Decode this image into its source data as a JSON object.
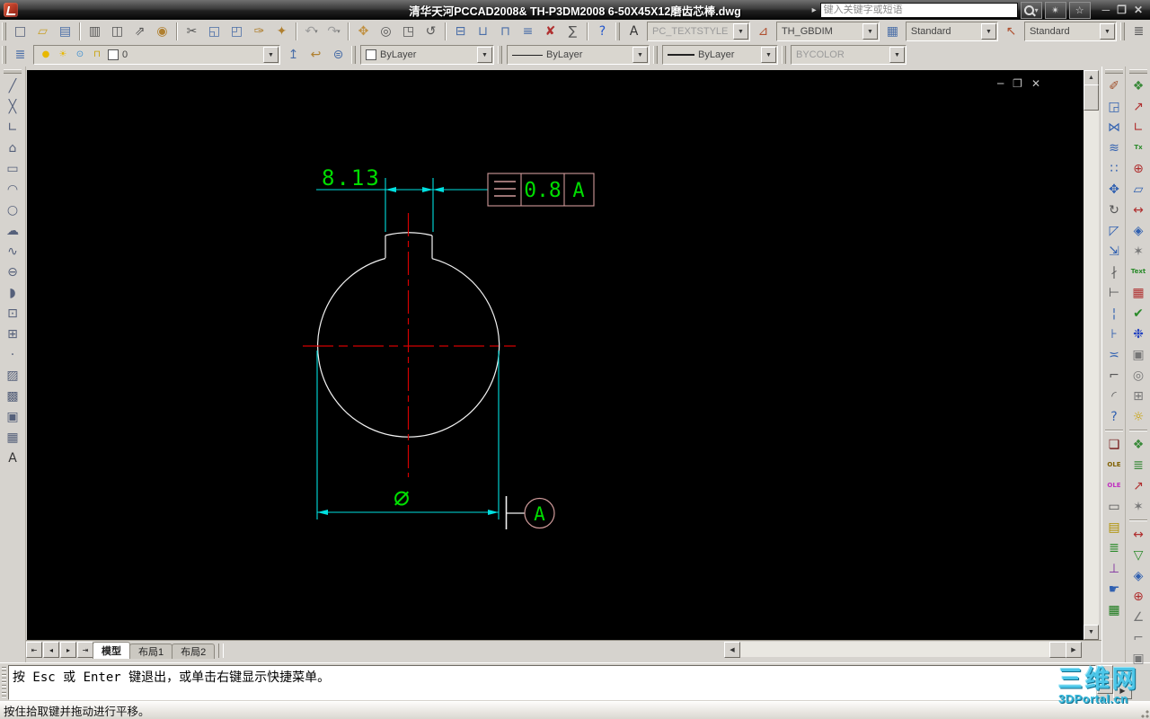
{
  "title_bar": {
    "app_title": "清华天河PCCAD2008& TH-P3DM2008 6-50X45X12磨齿芯棒.dwg",
    "comm_arrow": "▸",
    "search": {
      "placeholder": "键入关键字或短语"
    },
    "window_controls": {
      "minimize": "─",
      "restore": "❐",
      "close": "✕"
    }
  },
  "doc_window_controls": {
    "minimize": "─",
    "restore": "❐",
    "close": "✕"
  },
  "styles": {
    "text_style": {
      "value": "PC_TEXTSTYLE",
      "disabled": true
    },
    "dim_style": {
      "value": "TH_GBDIM"
    },
    "table_style": {
      "value": "Standard"
    },
    "mleader_style": {
      "value": "Standard"
    }
  },
  "layers": {
    "current_layer": "0",
    "color_value": "ByLayer",
    "linetype_value": "ByLayer",
    "lineweight_value": "ByLayer",
    "plot_style_value": "BYCOLOR"
  },
  "toolbars": {
    "standard": [
      {
        "type": "grip"
      },
      {
        "name": "new-drawing",
        "glyph": "□",
        "color": "#55607a"
      },
      {
        "name": "open-drawing",
        "glyph": "▱",
        "color": "#c8a028"
      },
      {
        "name": "save-drawing",
        "glyph": "▤",
        "color": "#4a6ea8"
      },
      {
        "type": "sep"
      },
      {
        "name": "print",
        "glyph": "▥",
        "color": "#555555"
      },
      {
        "name": "print-preview",
        "glyph": "◫",
        "color": "#555555"
      },
      {
        "name": "publish",
        "glyph": "⇗",
        "color": "#555555"
      },
      {
        "name": "plot-orb",
        "glyph": "◉",
        "color": "#b08030"
      },
      {
        "type": "sep"
      },
      {
        "name": "cut",
        "glyph": "✂",
        "color": "#555555"
      },
      {
        "name": "copy-clip",
        "glyph": "◱",
        "color": "#4a6ea8"
      },
      {
        "name": "paste-clip",
        "glyph": "◰",
        "color": "#4a6ea8"
      },
      {
        "name": "match-properties",
        "glyph": "✑",
        "color": "#b08030"
      },
      {
        "name": "block-editor",
        "glyph": "✦",
        "color": "#b08030"
      },
      {
        "type": "sep"
      },
      {
        "name": "undo",
        "glyph": "↶",
        "color": "#9c9c9c",
        "dd": true,
        "disabled": true
      },
      {
        "name": "redo",
        "glyph": "↷",
        "color": "#9c9c9c",
        "dd": true,
        "disabled": true
      },
      {
        "type": "sep"
      },
      {
        "name": "pan-realtime",
        "glyph": "✥",
        "color": "#c09040"
      },
      {
        "name": "zoom-realtime",
        "glyph": "◎",
        "color": "#555555"
      },
      {
        "name": "zoom-window",
        "glyph": "◳",
        "color": "#555555"
      },
      {
        "name": "zoom-previous",
        "glyph": "↺",
        "color": "#555555"
      },
      {
        "type": "sep"
      },
      {
        "name": "properties-palette",
        "glyph": "⊟",
        "color": "#4a6ea8"
      },
      {
        "name": "design-center",
        "glyph": "⊔",
        "color": "#4a6ea8"
      },
      {
        "name": "tool-palettes",
        "glyph": "⊓",
        "color": "#4a6ea8"
      },
      {
        "name": "sheet-set-manager",
        "glyph": "≡",
        "color": "#4a6ea8"
      },
      {
        "name": "markup-set-manager",
        "glyph": "✘",
        "color": "#b03030"
      },
      {
        "name": "quick-calc",
        "glyph": "∑",
        "color": "#555555"
      },
      {
        "type": "sep"
      },
      {
        "name": "help",
        "glyph": "?",
        "color": "#2255cc"
      },
      {
        "type": "grip"
      }
    ],
    "text_style_icon": [
      {
        "name": "text-style",
        "glyph": "A",
        "color": "#333333"
      }
    ],
    "dim_style_icon": [
      {
        "name": "dim-style",
        "glyph": "⊿",
        "color": "#b05030"
      }
    ],
    "table_style_icon": [
      {
        "name": "table-style",
        "glyph": "▦",
        "color": "#4a6ea8"
      }
    ],
    "mleader_style_icon": [
      {
        "name": "mleader-style",
        "glyph": "↖",
        "color": "#b05030"
      }
    ],
    "row1_tail": [
      {
        "type": "grip"
      },
      {
        "name": "clipped-toolbar",
        "glyph": "≣",
        "color": "#555555"
      }
    ],
    "layers_left": [
      {
        "type": "grip"
      },
      {
        "name": "layer-properties-manager",
        "glyph": "≣",
        "color": "#4a6ea8"
      }
    ],
    "layer_states": [
      {
        "name": "layer-on",
        "glyph": "●",
        "color": "#e8b800"
      },
      {
        "name": "layer-freeze",
        "glyph": "☀",
        "color": "#e8b800"
      },
      {
        "name": "layer-vp-freeze",
        "glyph": "⊙",
        "color": "#4090d0"
      },
      {
        "name": "layer-lock",
        "glyph": "⊓",
        "color": "#c8a000"
      }
    ],
    "layer_tools": [
      {
        "name": "make-object-layer-current",
        "glyph": "↥",
        "color": "#4a6ea8"
      },
      {
        "name": "layer-previous",
        "glyph": "↩",
        "color": "#b08030"
      },
      {
        "name": "layer-states-manager",
        "glyph": "⊜",
        "color": "#4a6ea8"
      }
    ],
    "draw": [
      {
        "type": "grip"
      },
      {
        "name": "line",
        "glyph": "╱",
        "color": "#55607a"
      },
      {
        "name": "construction-line",
        "glyph": "╳",
        "color": "#55607a"
      },
      {
        "name": "polyline",
        "glyph": "∟",
        "color": "#55607a"
      },
      {
        "name": "polygon",
        "glyph": "⌂",
        "color": "#55607a"
      },
      {
        "name": "rectangle",
        "glyph": "▭",
        "color": "#55607a"
      },
      {
        "name": "arc",
        "glyph": "◠",
        "color": "#55607a"
      },
      {
        "name": "circle",
        "glyph": "○",
        "color": "#55607a"
      },
      {
        "name": "revision-cloud",
        "glyph": "☁",
        "color": "#55607a"
      },
      {
        "name": "spline",
        "glyph": "∿",
        "color": "#55607a"
      },
      {
        "name": "ellipse",
        "glyph": "⊖",
        "color": "#55607a"
      },
      {
        "name": "ellipse-arc",
        "glyph": "◗",
        "color": "#55607a"
      },
      {
        "name": "insert-block",
        "glyph": "⊡",
        "color": "#55607a"
      },
      {
        "name": "make-block",
        "glyph": "⊞",
        "color": "#55607a"
      },
      {
        "name": "point",
        "glyph": "·",
        "color": "#55607a"
      },
      {
        "name": "hatch",
        "glyph": "▨",
        "color": "#55607a"
      },
      {
        "name": "gradient",
        "glyph": "▩",
        "color": "#55607a"
      },
      {
        "name": "region",
        "glyph": "▣",
        "color": "#55607a"
      },
      {
        "name": "table",
        "glyph": "▦",
        "color": "#55607a"
      },
      {
        "name": "multiline-text",
        "glyph": "A",
        "color": "#333333"
      }
    ],
    "modify": [
      {
        "type": "grip"
      },
      {
        "name": "erase",
        "glyph": "✐",
        "color": "#a0522d"
      },
      {
        "name": "copy-object",
        "glyph": "◲",
        "color": "#3060b0"
      },
      {
        "name": "mirror",
        "glyph": "⋈",
        "color": "#3060b0"
      },
      {
        "name": "offset",
        "glyph": "≋",
        "color": "#3060b0"
      },
      {
        "name": "array",
        "glyph": "∷",
        "color": "#3060b0"
      },
      {
        "name": "move",
        "glyph": "✥",
        "color": "#3060b0"
      },
      {
        "name": "rotate",
        "glyph": "↻",
        "color": "#555555"
      },
      {
        "name": "scale",
        "glyph": "◸",
        "color": "#3060b0"
      },
      {
        "name": "stretch",
        "glyph": "⇲",
        "color": "#3060b0"
      },
      {
        "name": "trim",
        "glyph": "∤",
        "color": "#555555"
      },
      {
        "name": "extend",
        "glyph": "⊢",
        "color": "#555555"
      },
      {
        "name": "break",
        "glyph": "¦",
        "color": "#3060b0"
      },
      {
        "name": "break-at-point",
        "glyph": "⊦",
        "color": "#3060b0"
      },
      {
        "name": "join",
        "glyph": "≍",
        "color": "#3060b0"
      },
      {
        "name": "chamfer",
        "glyph": "⌐",
        "color": "#555555"
      },
      {
        "name": "fillet",
        "glyph": "◜",
        "color": "#555555"
      },
      {
        "name": "modify-help",
        "glyph": "?",
        "color": "#3060b0"
      },
      {
        "type": "sep"
      },
      {
        "name": "ole-object",
        "glyph": "❏",
        "color": "#701010"
      },
      {
        "name": "ole-dwg",
        "text": "OLE",
        "color": "#806000"
      },
      {
        "name": "ole-update",
        "text": "OLE",
        "color": "#c030c0"
      },
      {
        "name": "ole-frame",
        "glyph": "▭",
        "color": "#555555"
      },
      {
        "name": "ole-print",
        "glyph": "▤",
        "color": "#b09000"
      },
      {
        "name": "bom-node",
        "glyph": "≣",
        "color": "#2a8a2a"
      },
      {
        "name": "flow-tree",
        "glyph": "⊥",
        "color": "#8030a0"
      },
      {
        "name": "callout",
        "glyph": "☛",
        "color": "#3060b0"
      },
      {
        "name": "part-table",
        "glyph": "▦",
        "color": "#1a7a1a"
      }
    ],
    "pccad": [
      {
        "type": "grip"
      },
      {
        "name": "new-frame",
        "glyph": "❖",
        "color": "#3a8a3a"
      },
      {
        "name": "balloon-leader",
        "glyph": "↗",
        "color": "#b03030"
      },
      {
        "name": "coordinate-dim",
        "glyph": "∟",
        "color": "#b03030"
      },
      {
        "name": "text-wave",
        "text": "Tx",
        "color": "#2a8a2a"
      },
      {
        "name": "symmetry-dim",
        "glyph": "⊕",
        "color": "#b03030"
      },
      {
        "name": "rotate-frame",
        "glyph": "▱",
        "color": "#3060b0"
      },
      {
        "name": "horizontal-dim",
        "glyph": "↔",
        "color": "#b03030"
      },
      {
        "name": "tolerance-frame",
        "glyph": "◈",
        "color": "#3060b0"
      },
      {
        "name": "auto-dim",
        "glyph": "✶",
        "color": "#777777"
      },
      {
        "name": "text-tool",
        "text": "Text",
        "color": "#2a8a2a"
      },
      {
        "name": "title-table",
        "glyph": "▦",
        "color": "#b03030"
      },
      {
        "name": "edit-check",
        "glyph": "✔",
        "color": "#2a8a2a"
      },
      {
        "name": "paint-splash",
        "glyph": "❉",
        "color": "#2040c0"
      },
      {
        "name": "image-frame",
        "glyph": "▣",
        "color": "#777777"
      },
      {
        "name": "detail-view",
        "glyph": "◎",
        "color": "#777777"
      },
      {
        "name": "sheet-add",
        "glyph": "⊞",
        "color": "#777777"
      },
      {
        "name": "tip-bulb",
        "glyph": "☼",
        "color": "#c8a000"
      },
      {
        "type": "sep"
      },
      {
        "name": "new-frame-2",
        "glyph": "❖",
        "color": "#3a8a3a"
      },
      {
        "name": "list-new",
        "glyph": "≣",
        "color": "#3a8a3a"
      },
      {
        "name": "balloon-leader-2",
        "glyph": "↗",
        "color": "#b03030"
      },
      {
        "name": "auto-dim-2",
        "glyph": "✶",
        "color": "#777777"
      },
      {
        "type": "sep"
      },
      {
        "name": "dim-arrow",
        "glyph": "↔",
        "color": "#b03030"
      },
      {
        "name": "surface-finish",
        "glyph": "▽",
        "color": "#2a8a2a"
      },
      {
        "name": "datum-frame",
        "glyph": "◈",
        "color": "#3060b0"
      },
      {
        "name": "symmetry-dim-2",
        "glyph": "⊕",
        "color": "#b03030"
      },
      {
        "name": "angle-dim",
        "glyph": "∠",
        "color": "#777777"
      },
      {
        "name": "weld-symbol",
        "glyph": "⌐",
        "color": "#777777"
      },
      {
        "name": "ole-frame-2",
        "glyph": "▣",
        "color": "#777777"
      }
    ]
  },
  "sheet_tabs": {
    "nav": {
      "first": "⇤",
      "prev": "◂",
      "next": "▸",
      "last": "⇥"
    },
    "items": [
      {
        "label": "模型",
        "active": true
      },
      {
        "label": "布局1",
        "active": false
      },
      {
        "label": "布局2",
        "active": false
      }
    ]
  },
  "command_window": {
    "line1": "按 Esc 或 Enter 键退出，或单击右键显示快捷菜单。"
  },
  "status_bar": {
    "message": "按住拾取键并拖动进行平移。"
  },
  "watermark": {
    "title": "三维网",
    "url": "3DPortal.cn"
  },
  "drawing": {
    "dim_width": "8.13",
    "tolerance_value": "0.8",
    "tolerance_datum": "A",
    "tolerance_symbol": "symmetry",
    "diameter_symbol": "∅",
    "datum_label": "A",
    "colors": {
      "dim_text": "#00dd00",
      "dim_line": "#00e0e0",
      "centerline": "#d40000",
      "geometry": "#f2f2f2",
      "frame": "#cf9a9a"
    }
  }
}
